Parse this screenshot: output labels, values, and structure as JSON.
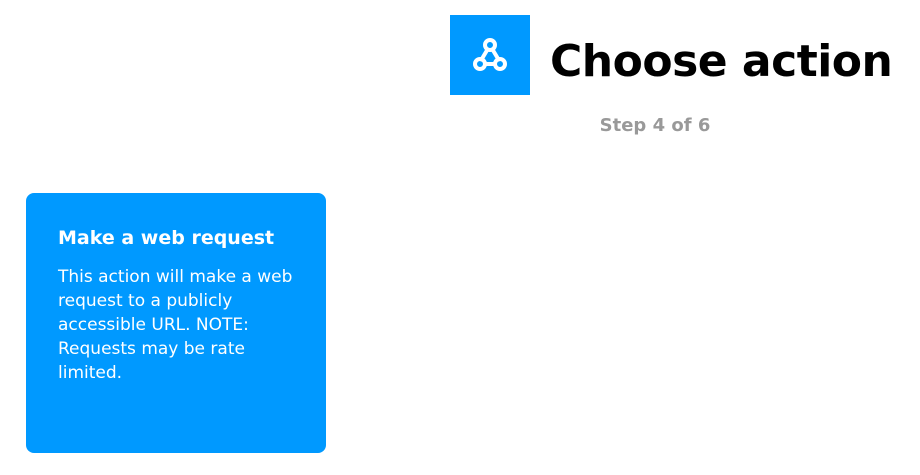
{
  "header": {
    "service_icon": "webhooks-icon",
    "title": "Choose action",
    "step": "Step 4 of 6"
  },
  "actions": [
    {
      "title": "Make a web request",
      "description": "This action will make a web request to a publicly accessible URL. NOTE: Requests may be rate limited."
    }
  ],
  "colors": {
    "brand_blue": "#0099ff",
    "title_text": "#000000",
    "step_text": "#999999",
    "card_text": "#ffffff"
  }
}
